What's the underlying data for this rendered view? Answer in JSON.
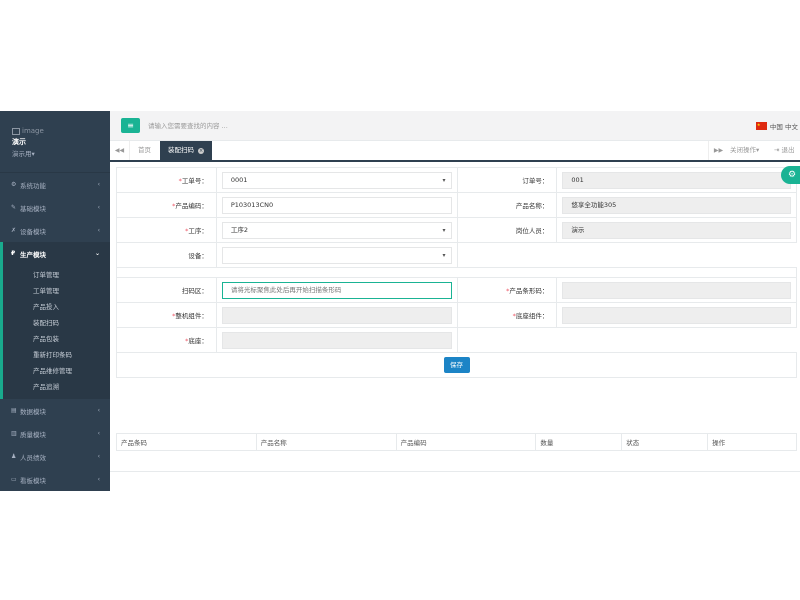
{
  "sidebar": {
    "image_alt": "image",
    "user_name": "演示",
    "user_role": "演示用",
    "items": [
      {
        "label": "系统功能",
        "icon": "gear-icon"
      },
      {
        "label": "基础模块",
        "icon": "wrench-icon"
      },
      {
        "label": "设备模块",
        "icon": "tool-icon"
      },
      {
        "label": "生产模块",
        "icon": "product-icon"
      },
      {
        "label": "数据模块",
        "icon": "file-icon"
      },
      {
        "label": "质量模块",
        "icon": "bar-chart-icon"
      },
      {
        "label": "人员绩效",
        "icon": "user-icon"
      },
      {
        "label": "看板模块",
        "icon": "monitor-icon"
      }
    ],
    "submenu": [
      "订单管理",
      "工单管理",
      "产品投入",
      "装配扫码",
      "产品包装",
      "重新打印条码",
      "产品维修管理",
      "产品追溯"
    ]
  },
  "topbar": {
    "search_placeholder": "请输入您需要查找的内容 ...",
    "language": "中国 中文"
  },
  "tabs": {
    "home": "首页",
    "active": "装配扫码",
    "close_ops": "关闭操作",
    "logout": "退出"
  },
  "form": {
    "work_order_label": "工单号：",
    "work_order_value": "0001",
    "order_no_label": "订单号：",
    "order_no_value": "001",
    "product_code_label": "产品编码：",
    "product_code_value": "P103013CN0",
    "product_name_label": "产品名称：",
    "product_name_value": "悠享全功能305",
    "process_label": "工序：",
    "process_value": "工序2",
    "position_staff_label": "岗位人员：",
    "position_staff_value": "演示",
    "device_label": "设备：",
    "device_value": "",
    "scan_label": "扫码区：",
    "scan_placeholder": "请将光标聚焦此处后再开始扫描条形码",
    "barcode_label": "产品条形码：",
    "chassis_label": "整机组件：",
    "seat_part_label": "底座组件：",
    "base_label": "底座：",
    "save_label": "保存"
  },
  "grid": {
    "columns": [
      "产品条码",
      "产品名称",
      "产品编码",
      "数量",
      "状态",
      "操作"
    ]
  },
  "colors": {
    "sidebar_bg": "#2f4050",
    "accent": "#1ab394",
    "save_button": "#1c84c6",
    "required": "#ed5565"
  }
}
